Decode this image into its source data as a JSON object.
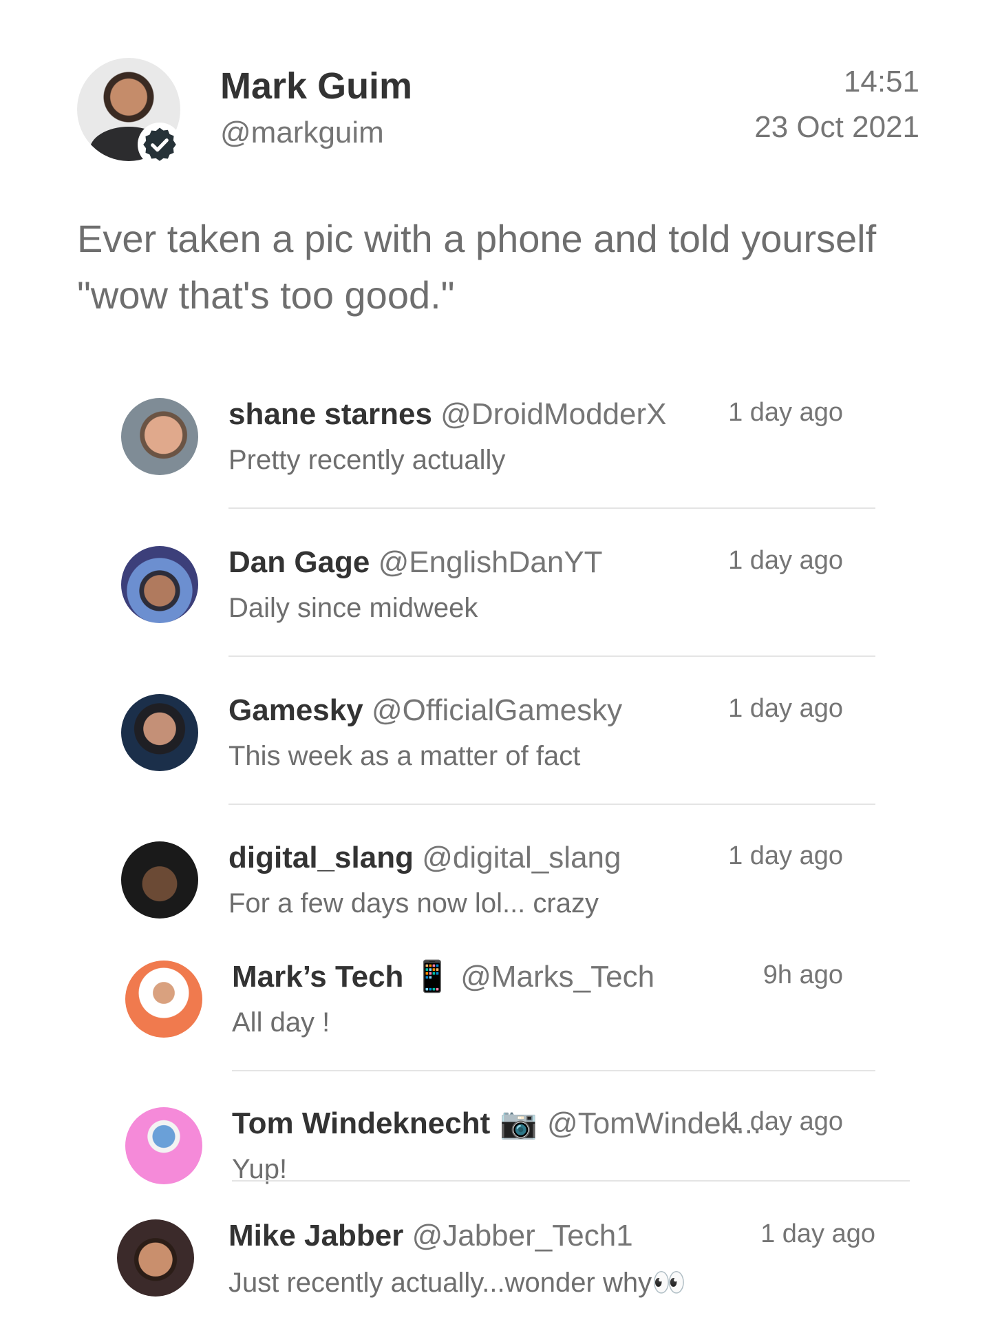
{
  "post": {
    "author_name": "Mark Guim",
    "author_handle": "@markguim",
    "time": "14:51",
    "date": "23 Oct 2021",
    "text": "Ever taken a pic with a phone and told yourself \"wow that's too good.\""
  },
  "replies": [
    {
      "name": "shane starnes",
      "emoji": "",
      "handle": "@DroidModderX",
      "time": "1 day ago",
      "text": "Pretty recently actually"
    },
    {
      "name": "Dan Gage",
      "emoji": "",
      "handle": "@EnglishDanYT",
      "time": "1 day ago",
      "text": "Daily since midweek"
    },
    {
      "name": "Gamesky",
      "emoji": "",
      "handle": "@OfficialGamesky",
      "time": "1 day ago",
      "text": "This week as a matter of fact"
    },
    {
      "name": "digital_slang",
      "emoji": "",
      "handle": "@digital_slang",
      "time": "1 day ago",
      "text": "For a few days now lol... crazy"
    },
    {
      "name": "Mark’s Tech",
      "emoji": "📱",
      "handle": "@Marks_Tech",
      "time": "9h ago",
      "text": "All day !"
    },
    {
      "name": "Tom Windeknecht",
      "emoji": "📷",
      "handle": "@TomWindek...",
      "time": "1 day ago",
      "text": "Yup!"
    },
    {
      "name": "Mike Jabber",
      "emoji": "",
      "handle": "@Jabber_Tech1",
      "time": "1 day ago",
      "text": "Just recently actually...wonder why👀"
    }
  ],
  "colors": {
    "verified_badge": "#263238",
    "name_text": "#333333",
    "secondary_text": "#757575",
    "divider": "#e4e4e4"
  }
}
